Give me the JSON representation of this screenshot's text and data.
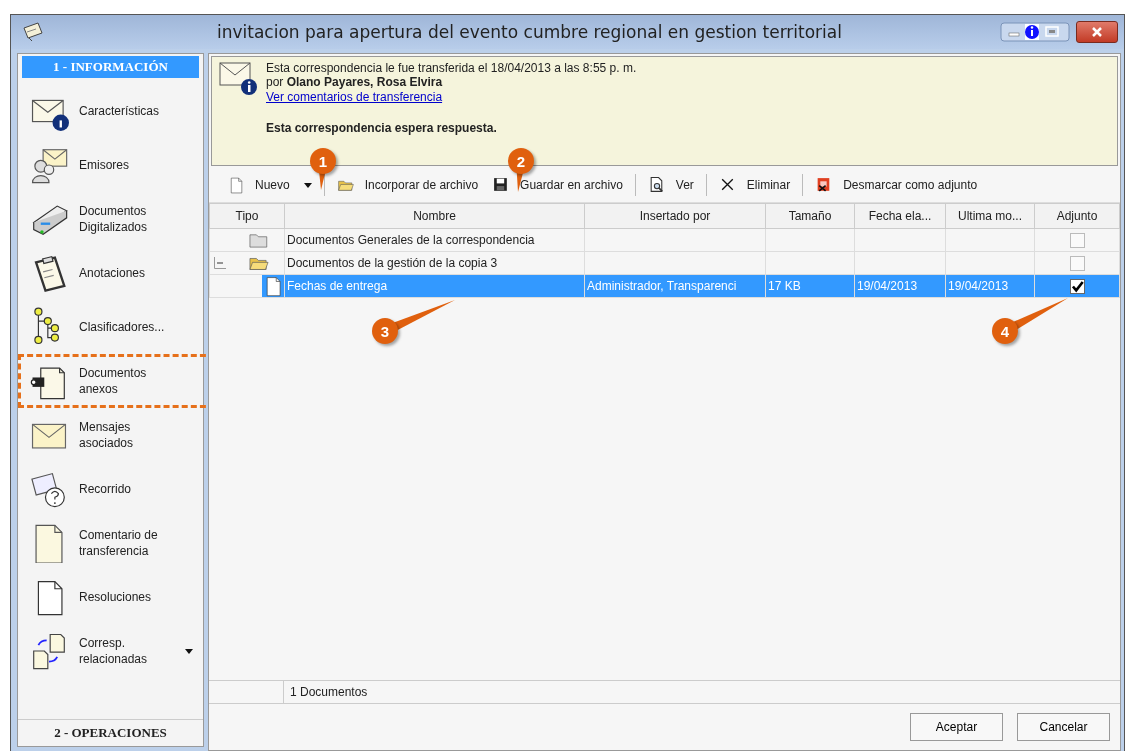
{
  "window": {
    "title": "invitacion para apertura del evento cumbre regional en gestion territorial"
  },
  "sidebar": {
    "header": "1 - INFORMACIÓN",
    "footer": "2 - OPERACIONES",
    "items": [
      {
        "label": "Características",
        "highlighted": false,
        "dropdown": false
      },
      {
        "label": "Emisores",
        "highlighted": false,
        "dropdown": false
      },
      {
        "label": "Documentos Digitalizados",
        "highlighted": false,
        "dropdown": false
      },
      {
        "label": "Anotaciones",
        "highlighted": false,
        "dropdown": false
      },
      {
        "label": "Clasificadores...",
        "highlighted": false,
        "dropdown": false
      },
      {
        "label": "Documentos anexos",
        "highlighted": true,
        "dropdown": false
      },
      {
        "label": "Mensajes asociados",
        "highlighted": false,
        "dropdown": false
      },
      {
        "label": "Recorrido",
        "highlighted": false,
        "dropdown": false
      },
      {
        "label": "Comentario de transferencia",
        "highlighted": false,
        "dropdown": false
      },
      {
        "label": "Resoluciones",
        "highlighted": false,
        "dropdown": false
      },
      {
        "label": "Corresp. relacionadas",
        "highlighted": false,
        "dropdown": true
      }
    ]
  },
  "notice": {
    "line_1": "Esta correspondencia le fue transferida el 18/04/2013 a las 8:55 p. m.",
    "line_2": "por **Olano Payares, Rosa Elvira**",
    "link": "Ver comentarios de transferencia",
    "status": "Esta correspondencia espera respuesta."
  },
  "toolbar": [
    {
      "kind": "button",
      "label": "Nuevo",
      "dropdown": true
    },
    {
      "kind": "separator"
    },
    {
      "kind": "button",
      "label": "Incorporar de archivo",
      "dropdown": false
    },
    {
      "kind": "button",
      "label": "Guardar en archivo",
      "dropdown": false
    },
    {
      "kind": "separator"
    },
    {
      "kind": "button",
      "label": "Ver",
      "dropdown": false
    },
    {
      "kind": "separator"
    },
    {
      "kind": "button",
      "label": "Eliminar",
      "dropdown": false
    },
    {
      "kind": "separator"
    },
    {
      "kind": "button",
      "label": "Desmarcar como adjunto",
      "dropdown": false
    }
  ],
  "table": {
    "columns": [
      "Tipo",
      "Nombre",
      "Insertado por",
      "Tamaño",
      "Fecha ela...",
      "Ultima mo...",
      "Adjunto"
    ],
    "rows": [
      {
        "kind": "folder",
        "name": "Documentos Generales de la correspondencia",
        "checked": false,
        "selected": false
      },
      {
        "kind": "folder",
        "name": "Documentos de la gestión de la copia 3",
        "checked": false,
        "selected": false,
        "expanded": true,
        "children": [
          {
            "kind": "document",
            "name": "Fechas de entrega",
            "inserted_by": "Administrador, Transparenci",
            "size": "17 KB",
            "created": "19/04/2013",
            "modified": "19/04/2013",
            "checked": true,
            "selected": true
          }
        ]
      }
    ]
  },
  "status_bar": "1 Documentos",
  "buttons": [
    "Aceptar",
    "Cancelar"
  ],
  "callouts": [
    "1",
    "2",
    "3",
    "4"
  ]
}
